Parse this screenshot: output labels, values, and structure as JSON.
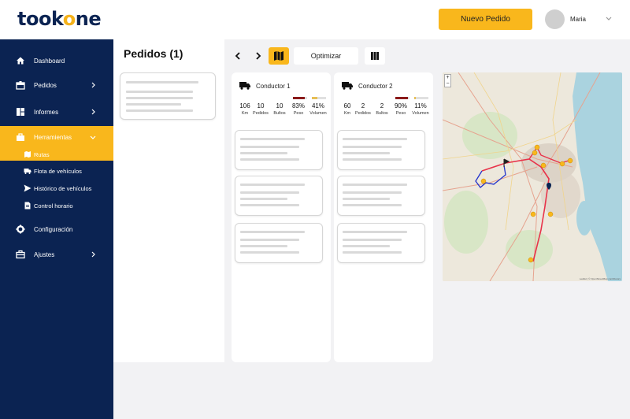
{
  "brand": {
    "name_pre": "took",
    "name_mid": "o",
    "name_post": "ne",
    "accent": "#f9b71c",
    "navy": "#0b2352"
  },
  "header": {
    "new_order_label": "Nuevo Pedido",
    "user_name": "Maria"
  },
  "sidebar": {
    "items": [
      {
        "label": "Dashboard",
        "icon": "home-icon"
      },
      {
        "label": "Pedidos",
        "icon": "box-icon"
      },
      {
        "label": "Informes",
        "icon": "chart-icon"
      },
      {
        "label": "Herramientas",
        "icon": "toolbox-icon"
      },
      {
        "label": "Configuración",
        "icon": "gear-icon"
      },
      {
        "label": "Ajustes",
        "icon": "briefcase-icon"
      }
    ],
    "subitems": [
      {
        "label": "Rutas",
        "icon": "map-icon"
      },
      {
        "label": "Flota de vehículos",
        "icon": "truck-icon"
      },
      {
        "label": "Histórico de vehículos",
        "icon": "send-icon"
      },
      {
        "label": "Control horario",
        "icon": "document-icon"
      }
    ]
  },
  "orders": {
    "title": "Pedidos (1)"
  },
  "toolbar": {
    "optimize_label": "Optimizar"
  },
  "drivers": [
    {
      "name": "Conductor 1",
      "km": "106",
      "km_label": "Km",
      "orders": "10",
      "orders_label": "Pedidos",
      "packages": "10",
      "packages_label": "Bultos",
      "weight": "83%",
      "weight_label": "Peso",
      "weight_fill": 0.83,
      "volume": "41%",
      "volume_label": "Volumen",
      "volume_fill": 0.41
    },
    {
      "name": "Conductor 2",
      "km": "60",
      "km_label": "Km",
      "orders": "2",
      "orders_label": "Pedidos",
      "packages": "2",
      "packages_label": "Bultos",
      "weight": "90%",
      "weight_label": "Peso",
      "weight_fill": 0.9,
      "volume": "11%",
      "volume_label": "Volumen",
      "volume_fill": 0.11
    }
  ],
  "map": {
    "zoom_in": "+",
    "zoom_out": "−",
    "attribution": "Leaflet | © OpenStreetMap contributors"
  }
}
